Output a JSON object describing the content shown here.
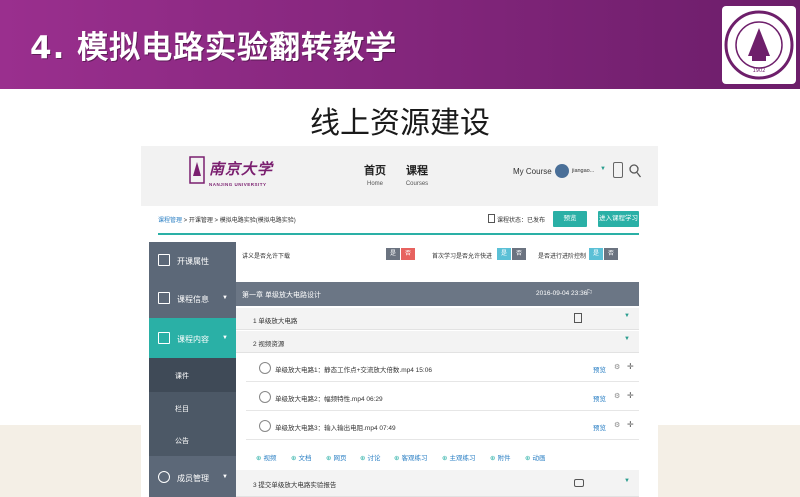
{
  "slide": {
    "title": "4. 模拟电路实验翻转教学",
    "subtitle": "线上资源建设",
    "seal_text": "NANJING UNIVERSITY"
  },
  "header": {
    "logo_cn": "南京大学",
    "logo_en": "NANJING UNIVERSITY",
    "nav": [
      {
        "label_cn": "首页",
        "label_en": "Home"
      },
      {
        "label_cn": "课程",
        "label_en": "Courses"
      }
    ],
    "my_course": "My Course",
    "user_name": "jiangao..."
  },
  "breadcrumb": {
    "root": "课程管理",
    "rest": " > 开课管理 > 模拟电路实验(模拟电路实验)"
  },
  "course_status": "课程状态：已发布",
  "buttons": {
    "preview": "预览",
    "enter_course": "进入课程学习"
  },
  "sidebar": {
    "items": [
      {
        "label": "开课属性"
      },
      {
        "label": "课程信息",
        "caret": "▼"
      },
      {
        "label": "课程内容",
        "caret": "▼"
      },
      {
        "label": "课件"
      },
      {
        "label": "栏目"
      },
      {
        "label": "公告"
      },
      {
        "label": "成员管理",
        "caret": "▼"
      }
    ]
  },
  "permissions": [
    {
      "label": "讲义是否允许下载",
      "yes": "是",
      "no": "否"
    },
    {
      "label": "首次学习是否允许快进",
      "yes": "是",
      "no": "否"
    },
    {
      "label": "是否进行进阶控制",
      "yes": "是",
      "no": "否"
    }
  ],
  "chapter": {
    "title": "第一章 单级放大电路设计",
    "date": "2016-09-04 23:36",
    "flag": "⚐"
  },
  "sections": [
    {
      "label": "1  单级放大电路",
      "caret": "▼"
    },
    {
      "label": "2  视频资源",
      "caret": "▼"
    },
    {
      "label": "3  提交单级放大电路实验报告",
      "caret": "▼"
    }
  ],
  "videos": [
    {
      "label": "单级放大电路1：静态工作点+交流放大倍数.mp4   15:06",
      "action": "预览"
    },
    {
      "label": "单级放大电路2：幅频特性.mp4   06:29",
      "action": "预览"
    },
    {
      "label": "单级放大电路3：输入输出电阻.mp4   07:49",
      "action": "预览"
    }
  ],
  "add_actions": [
    "视频",
    "文档",
    "网页",
    "讨论",
    "客观练习",
    "主观练习",
    "附件",
    "动画"
  ]
}
